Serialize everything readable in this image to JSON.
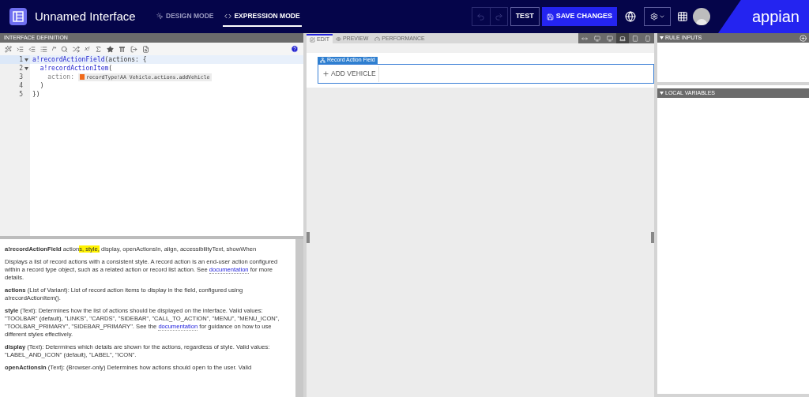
{
  "header": {
    "title": "Unnamed Interface",
    "modes": [
      {
        "label": "DESIGN MODE",
        "kind": "design",
        "selected": false
      },
      {
        "label": "EXPRESSION MODE",
        "kind": "expression",
        "selected": true
      }
    ],
    "test_button": "TEST",
    "save_button": "SAVE CHANGES",
    "logo": "appian"
  },
  "definition": {
    "title": "INTERFACE DEFINITION",
    "toolbar_glyphs": [
      "/*",
      "x!"
    ],
    "lines": [
      {
        "number": "1",
        "foldable": true,
        "selected": true,
        "tokens": [
          {
            "kind": "function",
            "text": "a!recordActionField"
          },
          {
            "kind": "plain",
            "text": "(actions: {"
          }
        ]
      },
      {
        "number": "2",
        "foldable": true,
        "selected": false,
        "tokens": [
          {
            "kind": "function",
            "text": "  a!recordActionItem"
          },
          {
            "kind": "plain",
            "text": "("
          }
        ]
      },
      {
        "number": "3",
        "foldable": false,
        "selected": false,
        "tokens": [
          {
            "kind": "key",
            "text": "    action:"
          },
          {
            "kind": "chip",
            "text": "recordType!AA Vehicle.actions.addVehicle"
          }
        ]
      },
      {
        "number": "4",
        "foldable": false,
        "selected": false,
        "tokens": [
          {
            "kind": "plain",
            "text": "  )"
          }
        ]
      },
      {
        "number": "5",
        "foldable": false,
        "selected": false,
        "tokens": [
          {
            "kind": "plain",
            "text": "})"
          }
        ]
      }
    ]
  },
  "help": {
    "signature": {
      "name": "a!recordActionField",
      "before": "action",
      "highlighted": "s, style,",
      "after": " display, openActionsIn, align, accessibilityText, showWhen"
    },
    "paragraphs": [
      {
        "text": "Displays a list of record actions with a consistent style. A record action is an end-user action configured within a record type object, such as a related action or record list action. See",
        "link": "documentation",
        "after": "for more details."
      },
      {
        "text": "**actions** (List of Variant): List of record action items to display in the field, configured using a!recordActionItem()."
      },
      {
        "text": "**style** (Text): Determines how the list of actions should be displayed on the interface. Valid values: \"TOOLBAR\" (default), \"LINKS\", \"CARDS\", \"SIDEBAR\", \"CALL_TO_ACTION\", \"MENU\", \"MENU_ICON\", \"TOOLBAR_PRIMARY\", \"SIDEBAR_PRIMARY\". See the",
        "link": "documentation",
        "after": "for guidance on how to use different styles effectively."
      },
      {
        "text": "**display** (Text): Determines which details are shown for the actions, regardless of style. Valid values: \"LABEL_AND_ICON\" (default), \"LABEL\", \"ICON\"."
      },
      {
        "text": "**openActionsIn** (Text): (Browser-only) Determines how actions should open to the user. Valid"
      }
    ]
  },
  "canvas": {
    "tabs": [
      {
        "label": "EDIT",
        "kind": "edit",
        "selected": true
      },
      {
        "label": "PREVIEW",
        "kind": "preview",
        "selected": false
      },
      {
        "label": "PERFORMANCE",
        "kind": "performance",
        "selected": false
      }
    ],
    "devices": [
      {
        "kind": "fit",
        "selected": false
      },
      {
        "kind": "wide",
        "selected": false
      },
      {
        "kind": "desktop",
        "selected": false
      },
      {
        "kind": "laptop",
        "selected": true
      },
      {
        "kind": "tablet",
        "selected": false
      },
      {
        "kind": "phone",
        "selected": false
      }
    ],
    "component_label": "Record Action Field",
    "action_button": "ADD VEHICLE"
  },
  "side": {
    "panels": [
      {
        "title": "RULE INPUTS",
        "addable": true
      },
      {
        "title": "LOCAL VARIABLES",
        "addable": false
      }
    ]
  }
}
